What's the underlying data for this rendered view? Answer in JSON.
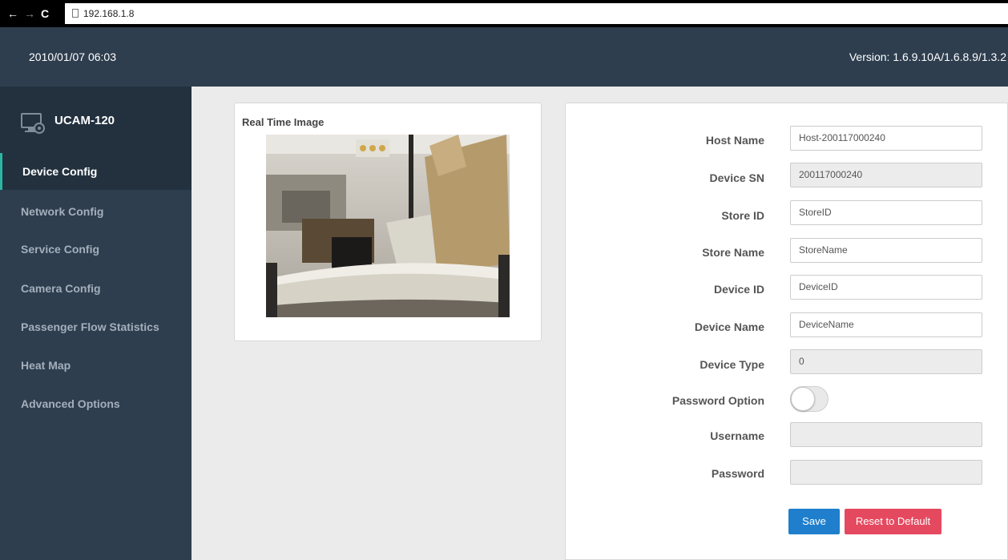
{
  "browser": {
    "back_glyph": "←",
    "forward_glyph": "→",
    "reload_glyph": "C",
    "url": "192.168.1.8"
  },
  "header": {
    "datetime": "2010/01/07 06:03",
    "version": "Version: 1.6.9.10A/1.6.8.9/1.3.2"
  },
  "sidebar": {
    "brand_icon": "monitor-gear-icon",
    "brand_name": "UCAM-120",
    "items": [
      {
        "label": "Device Config",
        "active": true
      },
      {
        "label": "Network Config"
      },
      {
        "label": "Service Config"
      },
      {
        "label": "Camera Config"
      },
      {
        "label": "Passenger Flow Statistics"
      },
      {
        "label": "Heat Map"
      },
      {
        "label": "Advanced Options"
      }
    ]
  },
  "image_panel": {
    "title": "Real Time Image"
  },
  "form": {
    "host_name": {
      "label": "Host Name",
      "value": "Host-200117000240"
    },
    "device_sn": {
      "label": "Device SN",
      "value": "200117000240"
    },
    "store_id": {
      "label": "Store ID",
      "value": "StoreID"
    },
    "store_name": {
      "label": "Store Name",
      "value": "StoreName"
    },
    "device_id": {
      "label": "Device ID",
      "value": "DeviceID"
    },
    "device_name": {
      "label": "Device Name",
      "value": "DeviceName"
    },
    "device_type": {
      "label": "Device Type",
      "value": "0"
    },
    "password_option": {
      "label": "Password Option",
      "enabled": false
    },
    "username": {
      "label": "Username",
      "value": ""
    },
    "password": {
      "label": "Password",
      "value": ""
    },
    "save_label": "Save",
    "reset_label": "Reset to Default"
  },
  "colors": {
    "header_bg": "#2e3e4f",
    "sidebar_active_bg": "#23313f",
    "accent": "#2bb6a3",
    "save": "#1f7fcc",
    "reset": "#e5495f"
  }
}
